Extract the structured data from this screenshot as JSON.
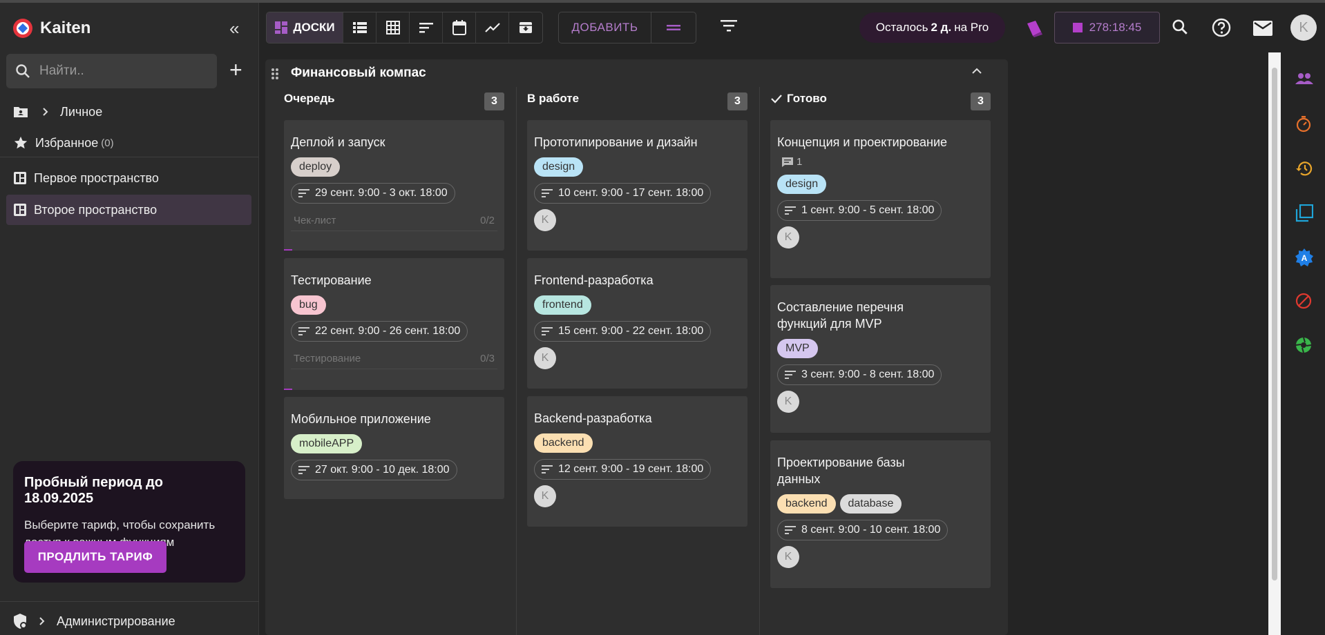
{
  "app": {
    "name": "Kaiten"
  },
  "sidebar": {
    "search_placeholder": "Найти..",
    "personal": "Личное",
    "favorites": "Избранное",
    "favorites_count": "(0)",
    "spaces": [
      {
        "label": "Первое пространство",
        "active": false
      },
      {
        "label": "Второе пространство",
        "active": true
      }
    ],
    "trial": {
      "title": "Пробный период до 18.09.2025",
      "text": "Выберите тариф, чтобы сохранить доступ к важным функциям",
      "button": "ПРОДЛИТЬ ТАРИФ"
    },
    "admin": "Администрирование"
  },
  "toolbar": {
    "boards_label": "ДОСКИ",
    "add_label": "ДОБАВИТЬ",
    "pro_prefix": "Осталось",
    "pro_days": "2 д.",
    "pro_suffix": "на Pro",
    "timer": "278:18:45",
    "user_initial": "K"
  },
  "board": {
    "title": "Финансовый компас",
    "columns": [
      {
        "title": "Очередь",
        "count": "3",
        "cards": [
          {
            "title": "Деплой и запуск",
            "tags": [
              "deploy"
            ],
            "date": "29 сент. 9:00 - 3 окт. 18:00",
            "checklist": "Чек-лист",
            "checklist_progress": "0/2"
          },
          {
            "title": "Тестирование",
            "tags": [
              "bug"
            ],
            "date": "22 сент. 9:00 - 26 сент. 18:00",
            "checklist": "Тестирование",
            "checklist_progress": "0/3"
          },
          {
            "title": "Мобильное приложение",
            "tags": [
              "mobileAPP"
            ],
            "date": "27 окт. 9:00 - 10 дек. 18:00"
          }
        ]
      },
      {
        "title": "В работе",
        "count": "3",
        "cards": [
          {
            "title": "Прототипирование и дизайн",
            "tags": [
              "design"
            ],
            "date": "10 сент. 9:00 - 17 сент. 18:00",
            "member": "K"
          },
          {
            "title": "Frontend-разработка",
            "tags": [
              "frontend"
            ],
            "date": "15 сент. 9:00 - 22 сент. 18:00",
            "member": "K"
          },
          {
            "title": "Backend-разработка",
            "tags": [
              "backend"
            ],
            "date": "12 сент. 9:00 - 19 сент. 18:00",
            "member": "K"
          }
        ]
      },
      {
        "title": "Готово",
        "count": "3",
        "cards": [
          {
            "title": "Концепция и проектирование",
            "comments": "1",
            "tags": [
              "design"
            ],
            "date": "1 сент. 9:00 - 5 сент. 18:00",
            "member": "K"
          },
          {
            "title": "Составление перечня функций для MVP",
            "tags": [
              "MVP"
            ],
            "date": "3 сент. 9:00 - 8 сент. 18:00",
            "member": "K"
          },
          {
            "title": "Проектирование базы данных",
            "tags": [
              "backend",
              "database"
            ],
            "date": "8 сент. 9:00 - 10 сент. 18:00",
            "member": "K"
          }
        ]
      }
    ]
  },
  "tag_colors": {
    "deploy": "#d7cfcb",
    "bug": "#f7c5d0",
    "mobileAPP": "#d7efc9",
    "design": "#b9e3f6",
    "frontend": "#b7e6e0",
    "backend": "#fbdfb2",
    "MVP": "#d5c7ef",
    "database": "#dcdcdc"
  },
  "colors": {
    "accent": "#a63bc0",
    "accent_text": "#b57dcc"
  }
}
